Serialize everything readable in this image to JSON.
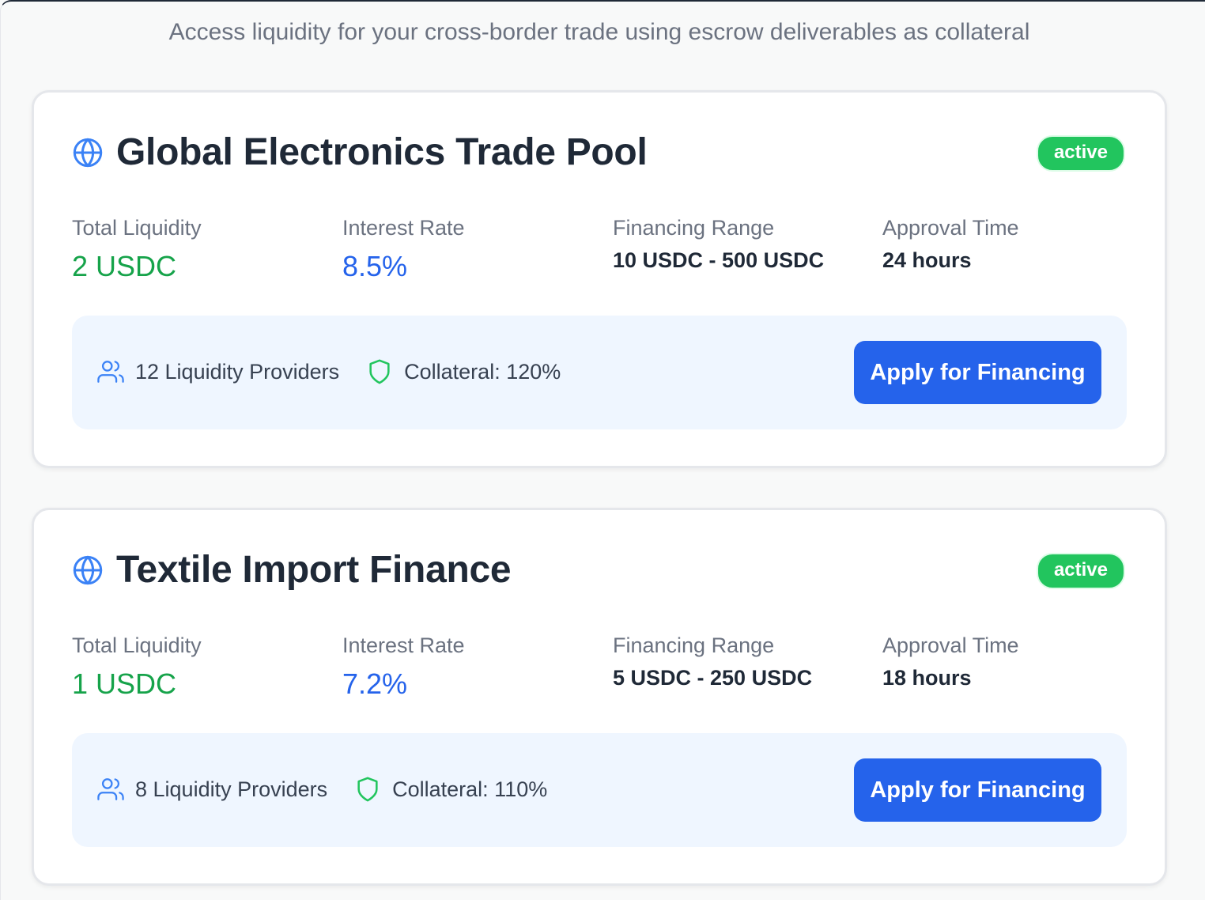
{
  "subtitle": "Access liquidity for your cross-border trade using escrow deliverables as collateral",
  "pools": [
    {
      "title": "Global Electronics Trade Pool",
      "status": "active",
      "total_liquidity_label": "Total Liquidity",
      "total_liquidity": "2 USDC",
      "interest_rate_label": "Interest Rate",
      "interest_rate": "8.5%",
      "financing_range_label": "Financing Range",
      "financing_range": "10 USDC - 500 USDC",
      "approval_time_label": "Approval Time",
      "approval_time": "24 hours",
      "providers": "12 Liquidity Providers",
      "collateral": "Collateral: 120%",
      "apply_label": "Apply for Financing"
    },
    {
      "title": "Textile Import Finance",
      "status": "active",
      "total_liquidity_label": "Total Liquidity",
      "total_liquidity": "1 USDC",
      "interest_rate_label": "Interest Rate",
      "interest_rate": "7.2%",
      "financing_range_label": "Financing Range",
      "financing_range": "5 USDC - 250 USDC",
      "approval_time_label": "Approval Time",
      "approval_time": "18 hours",
      "providers": "8 Liquidity Providers",
      "collateral": "Collateral: 110%",
      "apply_label": "Apply for Financing"
    }
  ],
  "colors": {
    "accent": "#2563eb",
    "success": "#22c55e",
    "liquidity_text": "#16a34a",
    "footer_bg": "#eff6ff"
  },
  "icons": {
    "title_icon": "globe-icon",
    "providers_icon": "users-icon",
    "collateral_icon": "shield-icon"
  }
}
